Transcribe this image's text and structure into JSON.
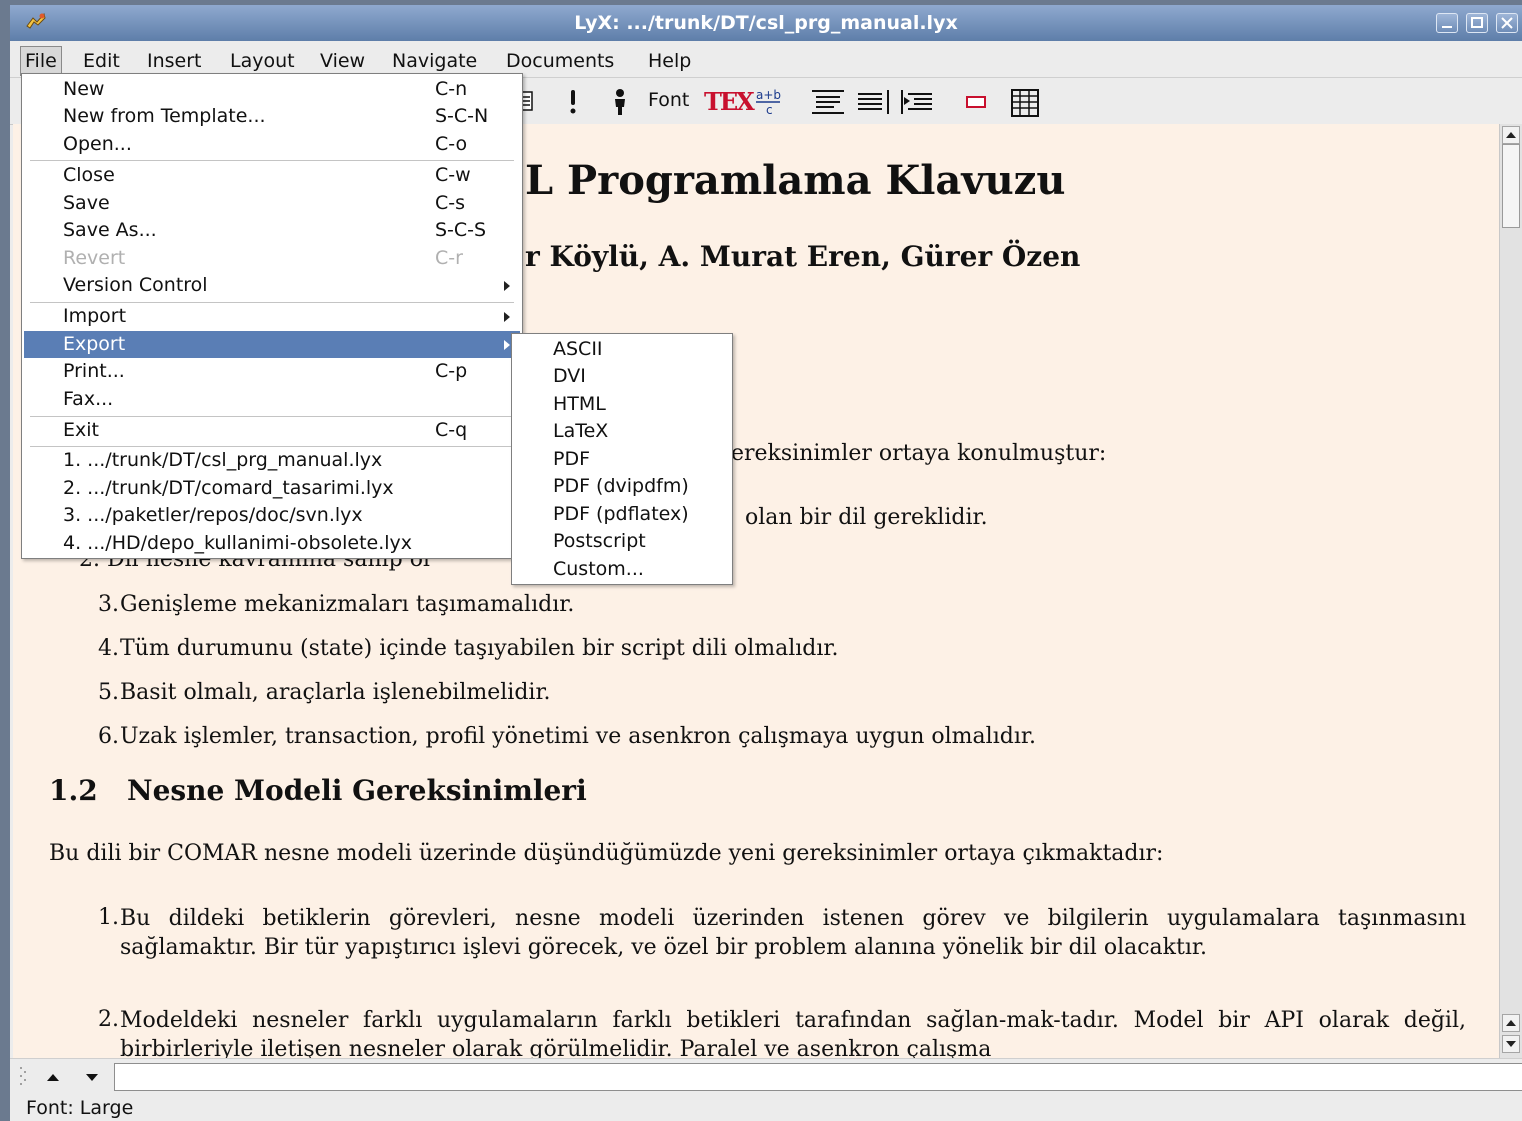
{
  "window": {
    "title": "LyX: .../trunk/DT/csl_prg_manual.lyx"
  },
  "menubar": [
    "File",
    "Edit",
    "Insert",
    "Layout",
    "View",
    "Navigate",
    "Documents",
    "Help"
  ],
  "toolbar": {
    "font_label": "Font",
    "tex_label": "TEX",
    "icons": [
      "paste-icon",
      "note-icon",
      "person-icon",
      "font-icon",
      "tex-icon",
      "math-icon",
      "list-icon",
      "enumerate-icon",
      "indent-icon",
      "box-icon",
      "table-icon"
    ]
  },
  "file_menu": {
    "items": [
      {
        "label": "New",
        "shortcut": "C-n"
      },
      {
        "label": "New from Template...",
        "shortcut": "S-C-N"
      },
      {
        "label": "Open...",
        "shortcut": "C-o"
      },
      {
        "label": "Close",
        "shortcut": "C-w"
      },
      {
        "label": "Save",
        "shortcut": "C-s"
      },
      {
        "label": "Save As...",
        "shortcut": "S-C-S"
      },
      {
        "label": "Revert",
        "shortcut": "C-r",
        "disabled": true
      },
      {
        "label": "Version Control",
        "shortcut": ""
      },
      {
        "label": "Import",
        "shortcut": ""
      },
      {
        "label": "Export",
        "shortcut": "",
        "highlighted": true
      },
      {
        "label": "Print...",
        "shortcut": "C-p"
      },
      {
        "label": "Fax...",
        "shortcut": ""
      },
      {
        "label": "Exit",
        "shortcut": "C-q"
      },
      {
        "label": "1. .../trunk/DT/csl_prg_manual.lyx",
        "shortcut": ""
      },
      {
        "label": "2. .../trunk/DT/comard_tasarimi.lyx",
        "shortcut": ""
      },
      {
        "label": "3. .../paketler/repos/doc/svn.lyx",
        "shortcut": ""
      },
      {
        "label": "4. .../HD/depo_kullanimi-obsolete.lyx",
        "shortcut": ""
      }
    ]
  },
  "export_menu": {
    "items": [
      "ASCII",
      "DVI",
      "HTML",
      "LaTeX",
      "PDF",
      "PDF (dvipdfm)",
      "PDF (pdflatex)",
      "Postscript",
      "Custom..."
    ]
  },
  "document": {
    "title": "L Programlama Klavuzu",
    "authors": "r Köylü, A. Murat Eren, Gürer Özen",
    "req_fragment": "ereksinimler ortaya konulmuştur:",
    "item1_fragment": "olan bir dil gereklidir.",
    "item2_fragment": "2.  Dil nesne kavramına sahip ol",
    "list1": [
      {
        "num": "3.",
        "text": "Genişleme mekanizmaları taşımamalıdır."
      },
      {
        "num": "4.",
        "text": "Tüm durumunu (state) içinde taşıyabilen bir script dili olmalıdır."
      },
      {
        "num": "5.",
        "text": "Basit olmalı, araçlarla işlenebilmelidir."
      },
      {
        "num": "6.",
        "text": "Uzak işlemler, transaction, profil yönetimi ve asenkron çalışmaya uygun olmalıdır."
      }
    ],
    "section_number": "1.2",
    "section_title": "Nesne Modeli Gereksinimleri",
    "paragraph": "Bu dili bir COMAR nesne modeli üzerinde düşündüğümüzde yeni gereksinimler ortaya çıkmaktadır:",
    "list2": [
      {
        "num": "1.",
        "text": "Bu dildeki betiklerin görevleri, nesne modeli üzerinden istenen görev ve bilgilerin uygulamalara taşınmasını sağlamaktır. Bir tür yapıştırıcı işlevi görecek, ve özel bir problem alanına yönelik bir dil olacaktır."
      },
      {
        "num": "2.",
        "text": "Modeldeki nesneler farklı uygulamaların farklı betikleri tarafından sağlan-mak-tadır. Model bir API olarak değil, birbirleriyle iletişen nesneler olarak görülmelidir. Paralel ve asenkron çalışma"
      }
    ]
  },
  "status": {
    "text": "Font: Large"
  },
  "colors": {
    "titlebar": "#6f8db7",
    "menu_highlight": "#5a7eb5",
    "document_bg": "#fdf1e6",
    "tex_red": "#c8102e"
  }
}
